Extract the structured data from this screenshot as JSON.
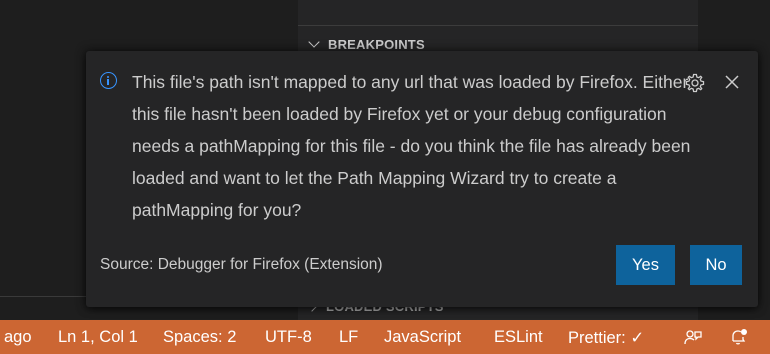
{
  "sidebar": {
    "breakpoints_header": "BREAKPOINTS",
    "loaded_scripts_header": "LOADED SCRIPTS"
  },
  "notification": {
    "icon": "info-icon",
    "message": "This file's path isn't mapped to any url that was loaded by Firefox. Either this file hasn't been loaded by Firefox yet or your debug configuration needs a pathMapping for this file - do you think the file has already been loaded and want to let the Path Mapping Wizard try to create a pathMapping for you?",
    "source": "Source: Debugger for Firefox (Extension)",
    "yes_label": "Yes",
    "no_label": "No",
    "button_color": "#0e639c",
    "info_color": "#3794ff"
  },
  "statusbar": {
    "background": "#cc6633",
    "items": [
      "ago",
      "Ln 1, Col 1",
      "Spaces: 2",
      "UTF-8",
      "LF",
      "JavaScript",
      "ESLint",
      "Prettier: ✓"
    ],
    "icons": [
      "feedback-icon",
      "notifications-bell-icon"
    ]
  }
}
